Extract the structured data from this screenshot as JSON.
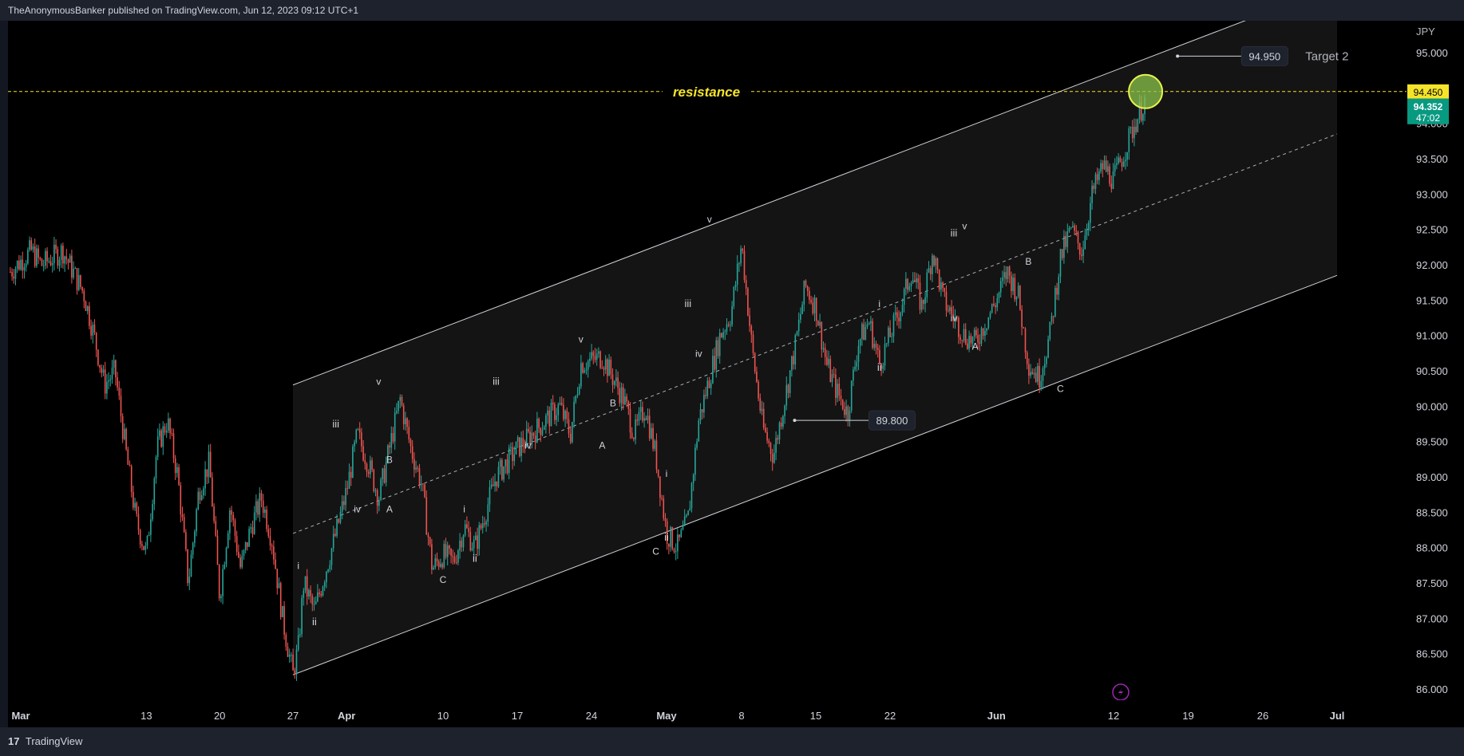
{
  "header": {
    "publisher_line": "TheAnonymousBanker published on TradingView.com, Jun 12, 2023 09:12 UTC+1"
  },
  "footer": {
    "logo_glyph": "17",
    "brand": "TradingView"
  },
  "colors": {
    "background": "#000000",
    "chrome": "#1e222d",
    "up_candle": "#26a69a",
    "down_candle": "#ef5350",
    "resistance_line": "#f5e42a",
    "channel_line": "#d1d4dc",
    "target_circle": "#8bc34a",
    "current_price_bg": "#089981",
    "resistance_price_bg": "#f5e42a"
  },
  "chart_data": {
    "type": "candlestick",
    "title": "",
    "currency": "JPY",
    "ylim": [
      85.7,
      95.6
    ],
    "y_ticks": [
      86.0,
      86.5,
      87.0,
      87.5,
      88.0,
      88.5,
      89.0,
      89.5,
      90.0,
      90.5,
      91.0,
      91.5,
      92.0,
      92.5,
      93.0,
      93.5,
      94.0,
      94.5,
      95.0
    ],
    "y_tick_labels": [
      "86.000",
      "86.500",
      "87.000",
      "87.500",
      "88.000",
      "88.500",
      "89.000",
      "89.500",
      "90.000",
      "90.500",
      "91.000",
      "91.500",
      "92.000",
      "92.500",
      "93.000",
      "93.500",
      "94.000",
      "94.500",
      "95.000"
    ],
    "x_range": [
      "2023-02-28",
      "2023-07-01"
    ],
    "x_ticks": [
      {
        "date": "2023-03-01",
        "label": "Mar"
      },
      {
        "date": "2023-03-13",
        "label": "13"
      },
      {
        "date": "2023-03-20",
        "label": "20"
      },
      {
        "date": "2023-03-27",
        "label": "27"
      },
      {
        "date": "2023-04-01",
        "label": "Apr"
      },
      {
        "date": "2023-04-10",
        "label": "10"
      },
      {
        "date": "2023-04-17",
        "label": "17"
      },
      {
        "date": "2023-04-24",
        "label": "24"
      },
      {
        "date": "2023-05-01",
        "label": "May"
      },
      {
        "date": "2023-05-08",
        "label": "8"
      },
      {
        "date": "2023-05-15",
        "label": "15"
      },
      {
        "date": "2023-05-22",
        "label": "22"
      },
      {
        "date": "2023-06-01",
        "label": "Jun"
      },
      {
        "date": "2023-06-12",
        "label": "12"
      },
      {
        "date": "2023-06-19",
        "label": "19"
      },
      {
        "date": "2023-06-26",
        "label": "26"
      },
      {
        "date": "2023-07-01",
        "label": "Jul"
      }
    ],
    "price_path": [
      [
        "2023-02-28",
        91.9
      ],
      [
        "2023-03-02",
        92.2
      ],
      [
        "2023-03-03",
        92.0
      ],
      [
        "2023-03-05",
        92.2
      ],
      [
        "2023-03-07",
        91.6
      ],
      [
        "2023-03-08",
        91.0
      ],
      [
        "2023-03-09",
        90.3
      ],
      [
        "2023-03-10",
        90.5
      ],
      [
        "2023-03-11",
        89.4
      ],
      [
        "2023-03-12",
        88.4
      ],
      [
        "2023-03-13",
        87.9
      ],
      [
        "2023-03-14",
        89.4
      ],
      [
        "2023-03-15",
        89.8
      ],
      [
        "2023-03-16",
        89.0
      ],
      [
        "2023-03-17",
        87.5
      ],
      [
        "2023-03-18",
        88.8
      ],
      [
        "2023-03-19",
        89.2
      ],
      [
        "2023-03-20",
        87.3
      ],
      [
        "2023-03-21",
        88.6
      ],
      [
        "2023-03-22",
        87.7
      ],
      [
        "2023-03-23",
        88.3
      ],
      [
        "2023-03-24",
        88.7
      ],
      [
        "2023-03-25",
        88.1
      ],
      [
        "2023-03-26",
        87.0
      ],
      [
        "2023-03-27",
        86.2
      ],
      [
        "2023-03-27T12",
        86.6
      ],
      [
        "2023-03-28",
        87.5
      ],
      [
        "2023-03-29",
        87.1
      ],
      [
        "2023-03-31",
        88.2
      ],
      [
        "2023-04-01",
        88.8
      ],
      [
        "2023-04-02",
        89.6
      ],
      [
        "2023-04-03",
        89.2
      ],
      [
        "2023-04-04",
        88.7
      ],
      [
        "2023-04-06",
        90.1
      ],
      [
        "2023-04-07",
        89.4
      ],
      [
        "2023-04-08",
        88.9
      ],
      [
        "2023-04-09",
        87.7
      ],
      [
        "2023-04-10",
        87.9
      ],
      [
        "2023-04-11",
        87.8
      ],
      [
        "2023-04-12",
        88.3
      ],
      [
        "2023-04-13",
        88.0
      ],
      [
        "2023-04-15",
        89.0
      ],
      [
        "2023-04-17",
        89.4
      ],
      [
        "2023-04-19",
        89.7
      ],
      [
        "2023-04-21",
        90.0
      ],
      [
        "2023-04-22",
        89.6
      ],
      [
        "2023-04-23",
        90.6
      ],
      [
        "2023-04-25",
        90.7
      ],
      [
        "2023-04-27",
        90.1
      ],
      [
        "2023-04-28",
        89.6
      ],
      [
        "2023-04-29",
        90.0
      ],
      [
        "2023-04-30",
        89.3
      ],
      [
        "2023-05-01",
        88.2
      ],
      [
        "2023-05-02",
        88.0
      ],
      [
        "2023-05-03",
        88.4
      ],
      [
        "2023-05-04",
        89.8
      ],
      [
        "2023-05-06",
        91.0
      ],
      [
        "2023-05-07",
        91.3
      ],
      [
        "2023-05-08",
        92.3
      ],
      [
        "2023-05-09",
        90.8
      ],
      [
        "2023-05-10",
        89.7
      ],
      [
        "2023-05-11",
        89.3
      ],
      [
        "2023-05-13",
        90.8
      ],
      [
        "2023-05-14",
        91.7
      ],
      [
        "2023-05-15",
        91.4
      ],
      [
        "2023-05-16",
        90.6
      ],
      [
        "2023-05-17",
        90.2
      ],
      [
        "2023-05-18",
        89.9
      ],
      [
        "2023-05-19",
        90.9
      ],
      [
        "2023-05-20",
        91.2
      ],
      [
        "2023-05-21",
        90.6
      ],
      [
        "2023-05-23",
        91.4
      ],
      [
        "2023-05-24",
        91.9
      ],
      [
        "2023-05-25",
        91.4
      ],
      [
        "2023-05-26",
        92.2
      ],
      [
        "2023-05-27",
        91.5
      ],
      [
        "2023-05-29",
        91.0
      ],
      [
        "2023-05-30",
        90.9
      ],
      [
        "2023-06-01",
        91.5
      ],
      [
        "2023-06-02",
        91.9
      ],
      [
        "2023-06-03",
        91.6
      ],
      [
        "2023-06-04",
        90.6
      ],
      [
        "2023-06-05",
        90.4
      ],
      [
        "2023-06-06",
        91.0
      ],
      [
        "2023-06-07",
        92.1
      ],
      [
        "2023-06-08",
        92.5
      ],
      [
        "2023-06-09",
        92.2
      ],
      [
        "2023-06-10",
        93.0
      ],
      [
        "2023-06-11",
        93.4
      ],
      [
        "2023-06-12",
        93.2
      ],
      [
        "2023-06-13",
        93.6
      ],
      [
        "2023-06-14",
        94.0
      ],
      [
        "2023-06-15",
        94.35
      ]
    ],
    "channel": {
      "upper": [
        [
          "2023-03-27",
          90.3
        ],
        [
          "2023-07-01",
          95.95
        ]
      ],
      "middle": [
        [
          "2023-03-27",
          88.2
        ],
        [
          "2023-07-01",
          93.85
        ]
      ],
      "lower": [
        [
          "2023-03-27",
          86.2
        ],
        [
          "2023-07-01",
          91.85
        ]
      ],
      "fill_until": "2023-07-01"
    },
    "resistance": {
      "label": "resistance",
      "price": 94.45
    },
    "current_price": {
      "value": "94.352",
      "countdown": "47:02"
    },
    "resistance_price_label": "94.450",
    "callouts": [
      {
        "label": "94.950",
        "price": 94.95,
        "from_date": "2023-06-18",
        "to_date": "2023-06-24"
      },
      {
        "label": "89.800",
        "price": 89.8,
        "from_date": "2023-05-13",
        "to_date": "2023-05-20"
      }
    ],
    "target_label": "Target 2",
    "target_circle": {
      "date": "2023-06-15",
      "price": 94.45
    },
    "wave_labels": [
      {
        "t": "i",
        "date": "2023-03-27T12",
        "price": 87.7
      },
      {
        "t": "ii",
        "date": "2023-03-29",
        "price": 86.9
      },
      {
        "t": "iii",
        "date": "2023-03-31",
        "price": 89.7
      },
      {
        "t": "iv",
        "date": "2023-04-02",
        "price": 88.5
      },
      {
        "t": "v",
        "date": "2023-04-04",
        "price": 90.3
      },
      {
        "t": "A",
        "date": "2023-04-05",
        "price": 88.5
      },
      {
        "t": "B",
        "date": "2023-04-05",
        "price": 89.2
      },
      {
        "t": "C",
        "date": "2023-04-10",
        "price": 87.5
      },
      {
        "t": "i",
        "date": "2023-04-12",
        "price": 88.5
      },
      {
        "t": "ii",
        "date": "2023-04-13",
        "price": 87.8
      },
      {
        "t": "iii",
        "date": "2023-04-15",
        "price": 90.3
      },
      {
        "t": "iv",
        "date": "2023-04-18",
        "price": 89.4
      },
      {
        "t": "v",
        "date": "2023-04-23",
        "price": 90.9
      },
      {
        "t": "A",
        "date": "2023-04-25",
        "price": 89.4
      },
      {
        "t": "B",
        "date": "2023-04-26",
        "price": 90.0
      },
      {
        "t": "C",
        "date": "2023-04-30",
        "price": 87.9
      },
      {
        "t": "i",
        "date": "2023-05-01",
        "price": 89.0
      },
      {
        "t": "ii",
        "date": "2023-05-01",
        "price": 88.1
      },
      {
        "t": "iii",
        "date": "2023-05-03",
        "price": 91.4
      },
      {
        "t": "iv",
        "date": "2023-05-04",
        "price": 90.7
      },
      {
        "t": "v",
        "date": "2023-05-05",
        "price": 92.6
      },
      {
        "t": "i",
        "date": "2023-05-21",
        "price": 91.4
      },
      {
        "t": "ii",
        "date": "2023-05-21",
        "price": 90.5
      },
      {
        "t": "iii",
        "date": "2023-05-28",
        "price": 92.4
      },
      {
        "t": "iv",
        "date": "2023-05-28",
        "price": 91.2
      },
      {
        "t": "v",
        "date": "2023-05-29",
        "price": 92.5
      },
      {
        "t": "A",
        "date": "2023-05-30",
        "price": 90.8
      },
      {
        "t": "B",
        "date": "2023-06-04",
        "price": 92.0
      },
      {
        "t": "C",
        "date": "2023-06-07",
        "price": 90.2
      }
    ],
    "grid": false,
    "legend": "none"
  }
}
